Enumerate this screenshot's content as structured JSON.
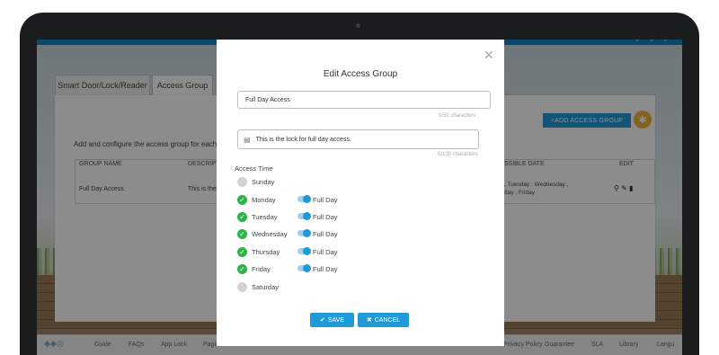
{
  "background_page": {
    "tabs": [
      {
        "label": "Smart Door/Lock/Reader"
      },
      {
        "label": "Access Group"
      }
    ],
    "intro_text": "Add and configure the access group for each us",
    "add_button_label": "+ADD ACCESS GROUP",
    "table": {
      "headers": {
        "group_name": "GROUP NAME",
        "description": "DESCRIPT",
        "accessible_date": "SSIBLE DATE",
        "edit": "EDIT"
      },
      "row": {
        "group_name": "Full Day Access",
        "description": "This is the",
        "accessible_date_line1": ", Tuesday , Wednesday ,",
        "accessible_date_line2": "day , Friday"
      }
    },
    "footer_links": [
      "Guide",
      "FAQs",
      "App Lock",
      "Pagin",
      "Privacy Policy",
      "Guarantee",
      "SLA",
      "Library",
      "Langu"
    ]
  },
  "modal": {
    "title": "Edit Access Group",
    "name_value": "Full Day Access",
    "name_count": "0/50 characters",
    "description_value": "This is the lock for full day access.",
    "description_count": "0/100 characters",
    "access_time_label": "Access Time",
    "days": [
      {
        "name": "Sunday",
        "checked": false,
        "toggle_label": ""
      },
      {
        "name": "Monday",
        "checked": true,
        "toggle_label": "Full Day"
      },
      {
        "name": "Tuesday",
        "checked": true,
        "toggle_label": "Full Day"
      },
      {
        "name": "Wednesday",
        "checked": true,
        "toggle_label": "Full Day"
      },
      {
        "name": "Thursday",
        "checked": true,
        "toggle_label": "Full Day"
      },
      {
        "name": "Friday",
        "checked": true,
        "toggle_label": "Full Day"
      },
      {
        "name": "Saturday",
        "checked": false,
        "toggle_label": ""
      }
    ],
    "save_label": "SAVE",
    "cancel_label": "CANCEL"
  },
  "colors": {
    "accent": "#1f9ad6",
    "check_green": "#2fb24a",
    "bulb": "#f0b23a"
  },
  "icons": [
    "close-icon",
    "description-icon",
    "check-icon",
    "save-check-icon",
    "cancel-x-icon",
    "lightbulb-icon",
    "search-icon",
    "edit-icon",
    "delete-icon"
  ]
}
